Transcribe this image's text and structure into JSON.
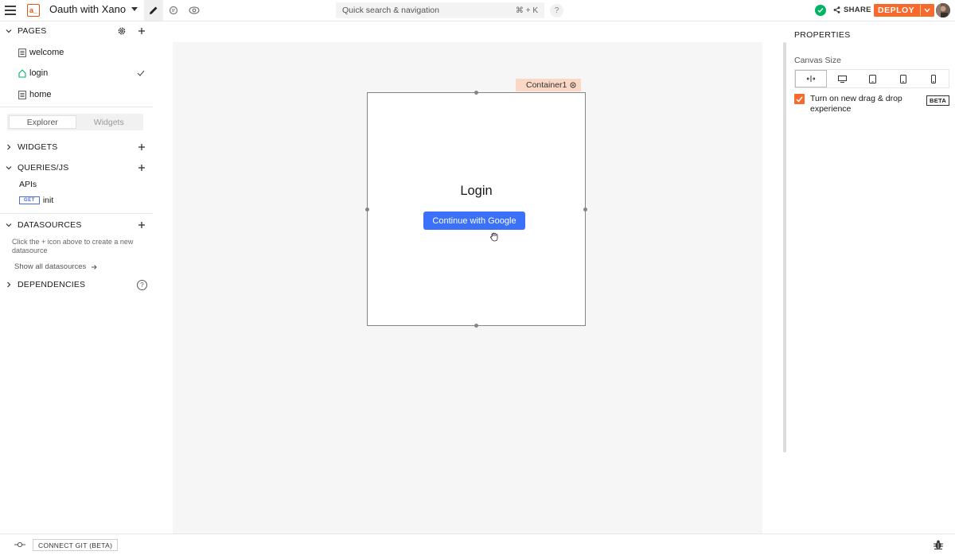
{
  "topbar": {
    "app_name": "Oauth with Xano",
    "logo_text": "a_",
    "search_placeholder": "Quick search & navigation",
    "search_shortcut": "⌘ + K",
    "help_label": "?",
    "share_label": "SHARE",
    "deploy_label": "DEPLOY",
    "accent_color": "#f86a2b"
  },
  "sidebar": {
    "pages_label": "PAGES",
    "pages": [
      {
        "name": "welcome",
        "icon": "page-icon"
      },
      {
        "name": "login",
        "icon": "home-icon",
        "selected": true
      },
      {
        "name": "home",
        "icon": "page-icon"
      }
    ],
    "tabs": [
      "Explorer",
      "Widgets"
    ],
    "active_tab": "Explorer",
    "widgets_label": "WIDGETS",
    "queries_label": "QUERIES/JS",
    "apis_label": "APIs",
    "query_method": "GET",
    "query_name": "init",
    "datasources_label": "DATASOURCES",
    "datasources_help": "Click the + icon above to create a new datasource",
    "show_datasources": "Show all datasources",
    "dependencies_label": "DEPENDENCIES",
    "dependencies_help": "?"
  },
  "canvas": {
    "container_name": "Container1",
    "login_title": "Login",
    "google_button": "Continue with Google",
    "primary_color": "#3b71f8"
  },
  "properties": {
    "title": "PROPERTIES",
    "canvas_size_label": "Canvas Size",
    "size_options": [
      "fluid-width-icon",
      "desktop-icon",
      "tablet-landscape-icon",
      "tablet-icon",
      "mobile-icon"
    ],
    "dnd_label": "Turn on new drag & drop experience",
    "dnd_checked": true,
    "beta_badge": "BETA"
  },
  "bottombar": {
    "connect_git": "CONNECT GIT (BETA)"
  }
}
